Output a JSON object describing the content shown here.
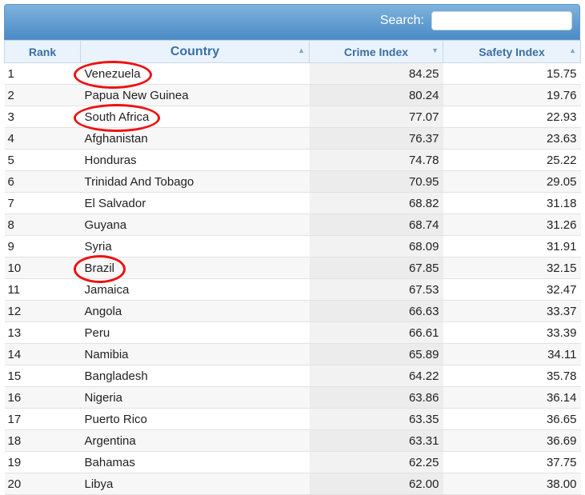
{
  "search": {
    "label": "Search:",
    "value": ""
  },
  "columns": [
    {
      "label": "Rank",
      "sort": ""
    },
    {
      "label": "Country",
      "sort": "▲"
    },
    {
      "label": "Crime Index",
      "sort": "▼"
    },
    {
      "label": "Safety Index",
      "sort": "▲"
    }
  ],
  "rows": [
    {
      "rank": "1",
      "country": "Venezuela",
      "crime": "84.25",
      "safety": "15.75"
    },
    {
      "rank": "2",
      "country": "Papua New Guinea",
      "crime": "80.24",
      "safety": "19.76"
    },
    {
      "rank": "3",
      "country": "South Africa",
      "crime": "77.07",
      "safety": "22.93"
    },
    {
      "rank": "4",
      "country": "Afghanistan",
      "crime": "76.37",
      "safety": "23.63"
    },
    {
      "rank": "5",
      "country": "Honduras",
      "crime": "74.78",
      "safety": "25.22"
    },
    {
      "rank": "6",
      "country": "Trinidad And Tobago",
      "crime": "70.95",
      "safety": "29.05"
    },
    {
      "rank": "7",
      "country": "El Salvador",
      "crime": "68.82",
      "safety": "31.18"
    },
    {
      "rank": "8",
      "country": "Guyana",
      "crime": "68.74",
      "safety": "31.26"
    },
    {
      "rank": "9",
      "country": "Syria",
      "crime": "68.09",
      "safety": "31.91"
    },
    {
      "rank": "10",
      "country": "Brazil",
      "crime": "67.85",
      "safety": "32.15"
    },
    {
      "rank": "11",
      "country": "Jamaica",
      "crime": "67.53",
      "safety": "32.47"
    },
    {
      "rank": "12",
      "country": "Angola",
      "crime": "66.63",
      "safety": "33.37"
    },
    {
      "rank": "13",
      "country": "Peru",
      "crime": "66.61",
      "safety": "33.39"
    },
    {
      "rank": "14",
      "country": "Namibia",
      "crime": "65.89",
      "safety": "34.11"
    },
    {
      "rank": "15",
      "country": "Bangladesh",
      "crime": "64.22",
      "safety": "35.78"
    },
    {
      "rank": "16",
      "country": "Nigeria",
      "crime": "63.86",
      "safety": "36.14"
    },
    {
      "rank": "17",
      "country": "Puerto Rico",
      "crime": "63.35",
      "safety": "36.65"
    },
    {
      "rank": "18",
      "country": "Argentina",
      "crime": "63.31",
      "safety": "36.69"
    },
    {
      "rank": "19",
      "country": "Bahamas",
      "crime": "62.25",
      "safety": "37.75"
    },
    {
      "rank": "20",
      "country": "Libya",
      "crime": "62.00",
      "safety": "38.00"
    }
  ],
  "highlighted_countries": [
    "Venezuela",
    "South Africa",
    "Brazil"
  ],
  "colors": {
    "header_bar": "#4a8ac6",
    "header_text": "#3a6fa6",
    "highlight": "#ee1111"
  }
}
